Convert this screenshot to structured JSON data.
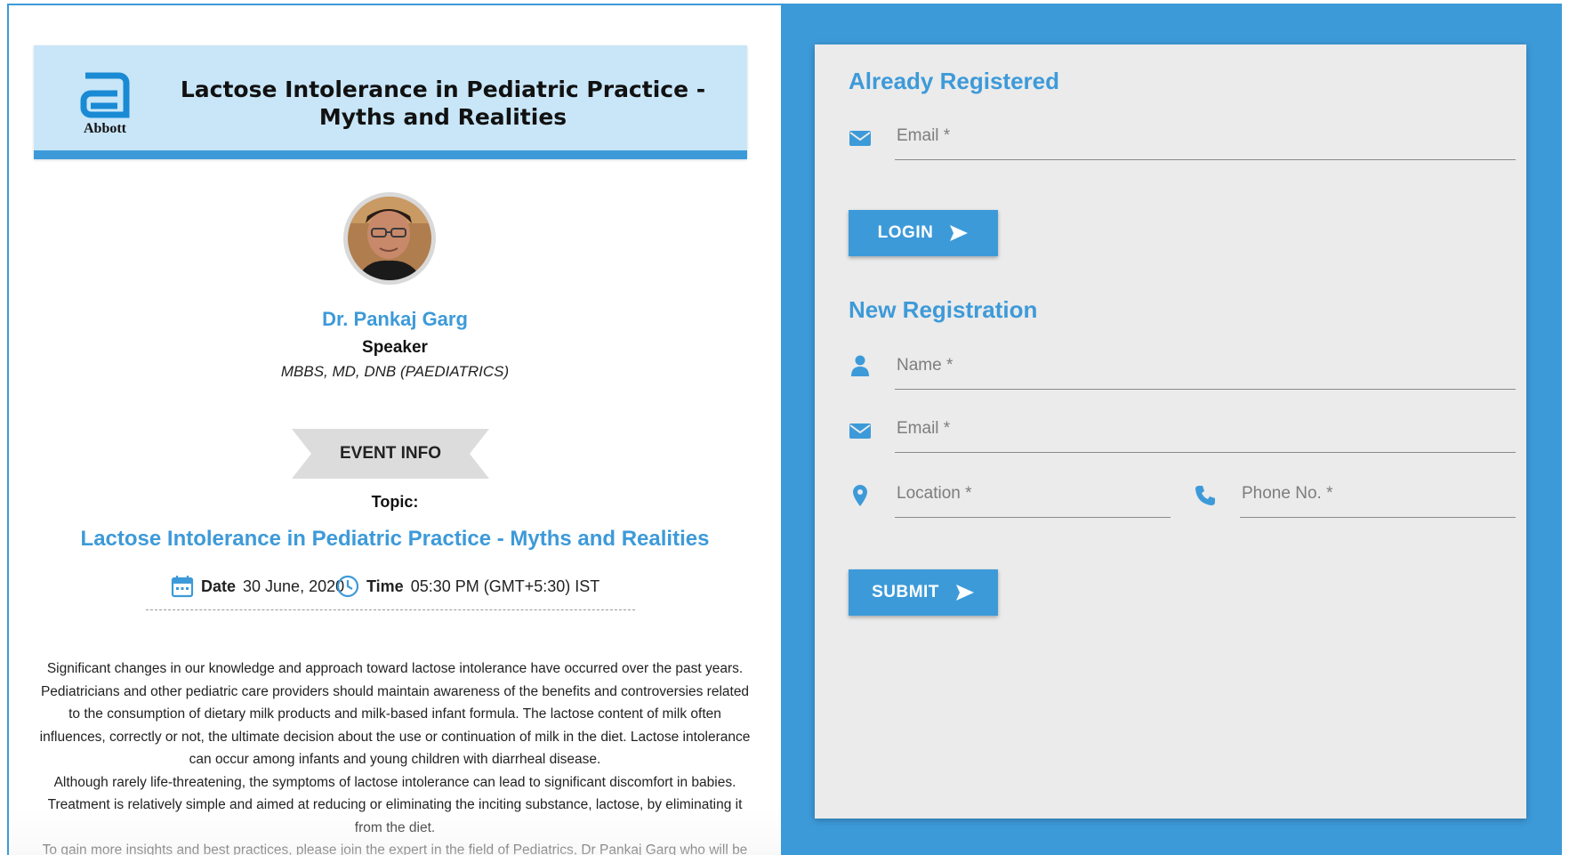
{
  "brand": {
    "logo_text": "Abbott"
  },
  "header": {
    "title": "Lactose Intolerance in Pediatric Practice - Myths and Realities"
  },
  "speaker": {
    "name": "Dr. Pankaj Garg",
    "role": "Speaker",
    "qualification": "MBBS, MD, DNB (PAEDIATRICS)"
  },
  "event": {
    "ribbon_label": "EVENT INFO",
    "topic_label": "Topic:",
    "topic": "Lactose Intolerance in Pediatric Practice - Myths and Realities",
    "date_label": "Date",
    "date_value": "30 June, 2020",
    "time_label": "Time",
    "time_value": "05:30 PM (GMT+5:30) IST",
    "description": [
      "Significant changes in our knowledge and approach toward lactose intolerance have occurred over the past years.",
      "Pediatricians and other pediatric care providers should maintain awareness of the benefits and controversies related",
      "to the consumption of dietary milk products and milk-based infant formula. The lactose content of milk often",
      "influences, correctly or not, the ultimate decision about the use or continuation of milk in the diet. Lactose intolerance",
      "can occur among infants and young children with diarrheal disease.",
      "Although rarely life-threatening, the symptoms of lactose intolerance can lead to significant discomfort in babies.",
      "Treatment is relatively simple and aimed at reducing or eliminating the inciting substance, lactose, by eliminating it",
      "from the diet.",
      "To gain more insights and best practices, please join the expert in the field of Pediatrics, Dr Pankaj Garg who will be"
    ]
  },
  "login": {
    "title": "Already Registered",
    "email_placeholder": "Email *",
    "email_value": "",
    "button_label": "LOGIN"
  },
  "registration": {
    "title": "New Registration",
    "name_placeholder": "Name *",
    "email_placeholder": "Email *",
    "location_placeholder": "Location *",
    "phone_placeholder": "Phone No. *",
    "button_label": "SUBMIT"
  },
  "colors": {
    "accent": "#3d9ad9",
    "header_bg": "#c8e6f8",
    "card_bg": "#ebebeb"
  }
}
